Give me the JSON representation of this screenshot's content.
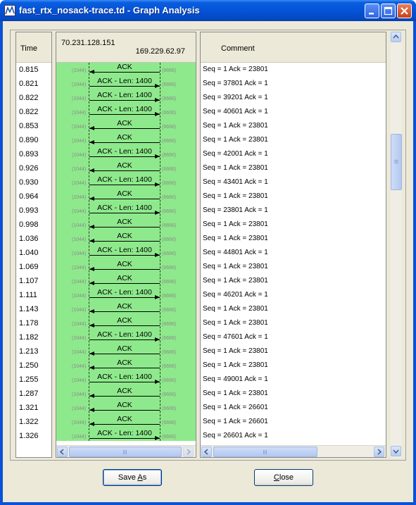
{
  "window": {
    "title": "fast_rtx_nosack-trace.td - Graph Analysis",
    "controls": [
      "minimize-icon",
      "maximize-icon",
      "close-icon"
    ]
  },
  "columns": {
    "time_header": "Time",
    "host_left": "70.231.128.151",
    "host_right": "169.229.62.97",
    "comment_header": "Comment"
  },
  "rows": [
    {
      "time": "0.815",
      "label": "ACK",
      "dir": "left",
      "port_left": "(1044)",
      "port_right": "(6666)",
      "comment": "Seq = 1 Ack = 23801"
    },
    {
      "time": "0.821",
      "label": "ACK - Len: 1400",
      "dir": "right",
      "port_left": "(1044)",
      "port_right": "(6666)",
      "comment": "Seq = 37801 Ack = 1"
    },
    {
      "time": "0.822",
      "label": "ACK - Len: 1400",
      "dir": "right",
      "port_left": "(1044)",
      "port_right": "(6666)",
      "comment": "Seq = 39201 Ack = 1"
    },
    {
      "time": "0.822",
      "label": "ACK - Len: 1400",
      "dir": "right",
      "port_left": "(1044)",
      "port_right": "(6666)",
      "comment": "Seq = 40601 Ack = 1"
    },
    {
      "time": "0.853",
      "label": "ACK",
      "dir": "left",
      "port_left": "(1044)",
      "port_right": "(6666)",
      "comment": "Seq = 1 Ack = 23801"
    },
    {
      "time": "0.890",
      "label": "ACK",
      "dir": "left",
      "port_left": "(1044)",
      "port_right": "(6666)",
      "comment": "Seq = 1 Ack = 23801"
    },
    {
      "time": "0.893",
      "label": "ACK - Len: 1400",
      "dir": "right",
      "port_left": "(1044)",
      "port_right": "(6666)",
      "comment": "Seq = 42001 Ack = 1"
    },
    {
      "time": "0.926",
      "label": "ACK",
      "dir": "left",
      "port_left": "(1044)",
      "port_right": "(6666)",
      "comment": "Seq = 1 Ack = 23801"
    },
    {
      "time": "0.930",
      "label": "ACK - Len: 1400",
      "dir": "right",
      "port_left": "(1044)",
      "port_right": "(6666)",
      "comment": "Seq = 43401 Ack = 1"
    },
    {
      "time": "0.964",
      "label": "ACK",
      "dir": "left",
      "port_left": "(1044)",
      "port_right": "(6666)",
      "comment": "Seq = 1 Ack = 23801"
    },
    {
      "time": "0.993",
      "label": "ACK - Len: 1400",
      "dir": "right",
      "port_left": "(1044)",
      "port_right": "(6666)",
      "comment": "Seq = 23801 Ack = 1"
    },
    {
      "time": "0.998",
      "label": "ACK",
      "dir": "left",
      "port_left": "(1044)",
      "port_right": "(6666)",
      "comment": "Seq = 1 Ack = 23801"
    },
    {
      "time": "1.036",
      "label": "ACK",
      "dir": "left",
      "port_left": "(1044)",
      "port_right": "(6666)",
      "comment": "Seq = 1 Ack = 23801"
    },
    {
      "time": "1.040",
      "label": "ACK - Len: 1400",
      "dir": "right",
      "port_left": "(1044)",
      "port_right": "(6666)",
      "comment": "Seq = 44801 Ack = 1"
    },
    {
      "time": "1.069",
      "label": "ACK",
      "dir": "left",
      "port_left": "(1044)",
      "port_right": "(6666)",
      "comment": "Seq = 1 Ack = 23801"
    },
    {
      "time": "1.107",
      "label": "ACK",
      "dir": "left",
      "port_left": "(1044)",
      "port_right": "(6666)",
      "comment": "Seq = 1 Ack = 23801"
    },
    {
      "time": "1.111",
      "label": "ACK - Len: 1400",
      "dir": "right",
      "port_left": "(1044)",
      "port_right": "(6666)",
      "comment": "Seq = 46201 Ack = 1"
    },
    {
      "time": "1.143",
      "label": "ACK",
      "dir": "left",
      "port_left": "(1044)",
      "port_right": "(6666)",
      "comment": "Seq = 1 Ack = 23801"
    },
    {
      "time": "1.178",
      "label": "ACK",
      "dir": "left",
      "port_left": "(1044)",
      "port_right": "(6666)",
      "comment": "Seq = 1 Ack = 23801"
    },
    {
      "time": "1.182",
      "label": "ACK - Len: 1400",
      "dir": "right",
      "port_left": "(1044)",
      "port_right": "(6666)",
      "comment": "Seq = 47601 Ack = 1"
    },
    {
      "time": "1.213",
      "label": "ACK",
      "dir": "left",
      "port_left": "(1044)",
      "port_right": "(6666)",
      "comment": "Seq = 1 Ack = 23801"
    },
    {
      "time": "1.250",
      "label": "ACK",
      "dir": "left",
      "port_left": "(1044)",
      "port_right": "(6666)",
      "comment": "Seq = 1 Ack = 23801"
    },
    {
      "time": "1.255",
      "label": "ACK - Len: 1400",
      "dir": "right",
      "port_left": "(1044)",
      "port_right": "(6666)",
      "comment": "Seq = 49001 Ack = 1"
    },
    {
      "time": "1.287",
      "label": "ACK",
      "dir": "left",
      "port_left": "(1044)",
      "port_right": "(6666)",
      "comment": "Seq = 1 Ack = 23801"
    },
    {
      "time": "1.321",
      "label": "ACK",
      "dir": "left",
      "port_left": "(1044)",
      "port_right": "(6666)",
      "comment": "Seq = 1 Ack = 26601"
    },
    {
      "time": "1.322",
      "label": "ACK",
      "dir": "left",
      "port_left": "(1044)",
      "port_right": "(6666)",
      "comment": "Seq = 1 Ack = 26601"
    },
    {
      "time": "1.326",
      "label": "ACK - Len: 1400",
      "dir": "right",
      "port_left": "(1044)",
      "port_right": "(6666)",
      "comment": "Seq = 26601 Ack = 1"
    }
  ],
  "buttons": {
    "save_as_pre": "Save ",
    "save_as_mnemonic": "A",
    "save_as_post": "s",
    "close_mnemonic": "C",
    "close_post": "lose"
  },
  "colors": {
    "graph_background": "#8ee98c",
    "titlebar": "#0553d6"
  }
}
